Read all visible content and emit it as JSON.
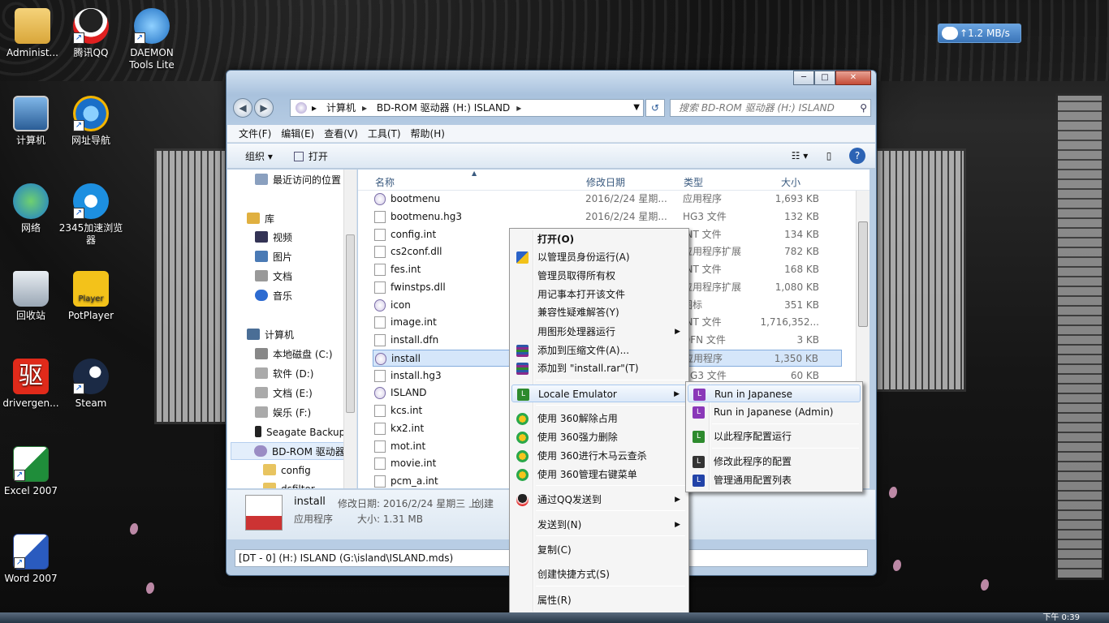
{
  "desktop": {
    "icons": [
      {
        "label": "Administ...",
        "name": "administrator-folder"
      },
      {
        "label": "腾讯QQ",
        "name": "qq"
      },
      {
        "label": "DAEMON Tools Lite",
        "name": "daemon-tools"
      },
      {
        "label": "计算机",
        "name": "computer"
      },
      {
        "label": "网址导航",
        "name": "web-nav"
      },
      {
        "label": "网络",
        "name": "network"
      },
      {
        "label": "2345加速浏览器",
        "name": "browser-2345"
      },
      {
        "label": "回收站",
        "name": "recycle-bin"
      },
      {
        "label": "PotPlayer",
        "name": "potplayer"
      },
      {
        "label": "drivergen...",
        "name": "drivergenius"
      },
      {
        "label": "Steam",
        "name": "steam"
      },
      {
        "label": "Excel 2007",
        "name": "excel"
      },
      {
        "label": "Word 2007",
        "name": "word"
      }
    ],
    "net_speed": "1.2 MB/s",
    "potplayer_badge": "Player",
    "drivergen_glyph": "驱"
  },
  "explorer": {
    "caption": {
      "min": "─",
      "max": "□",
      "close": "✕"
    },
    "address": {
      "crumbs": [
        "计算机",
        "BD-ROM 驱动器 (H:) ISLAND"
      ],
      "search_placeholder": "搜索 BD-ROM 驱动器 (H:) ISLAND"
    },
    "menu": [
      "文件(F)",
      "编辑(E)",
      "查看(V)",
      "工具(T)",
      "帮助(H)"
    ],
    "toolbar": {
      "organize": "组织 ▾",
      "open": "打开"
    },
    "nav_pane": [
      {
        "label": "最近访问的位置",
        "color": "#8aa0bf"
      },
      {
        "label": "库",
        "color": "#e0b040"
      },
      {
        "label": "视频",
        "color": "#335"
      },
      {
        "label": "图片",
        "color": "#4a7ab5"
      },
      {
        "label": "文档",
        "color": "#999"
      },
      {
        "label": "音乐",
        "color": "#2d6bd1"
      },
      {
        "label": "计算机",
        "color": "#4a6e96"
      },
      {
        "label": "本地磁盘 (C:)",
        "color": "#888"
      },
      {
        "label": "软件 (D:)",
        "color": "#aaa"
      },
      {
        "label": "文档 (E:)",
        "color": "#aaa"
      },
      {
        "label": "娱乐 (F:)",
        "color": "#aaa"
      },
      {
        "label": "Seagate Backup",
        "color": "#222"
      },
      {
        "label": "BD-ROM 驱动器",
        "color": "#9a8cc4"
      },
      {
        "label": "config",
        "color": "#e8c460"
      },
      {
        "label": "dsfiltor",
        "color": "#e8c460"
      }
    ],
    "columns": {
      "name": "名称",
      "date": "修改日期",
      "type": "类型",
      "size": "大小"
    },
    "files": [
      {
        "name": "bootmenu",
        "date": "2016/2/24 星期...",
        "type": "应用程序",
        "size": "1,693 KB",
        "app": true
      },
      {
        "name": "bootmenu.hg3",
        "date": "2016/2/24 星期...",
        "type": "HG3 文件",
        "size": "132 KB",
        "app": false
      },
      {
        "name": "config.int",
        "date": "",
        "type": "INT 文件",
        "size": "134 KB",
        "app": false
      },
      {
        "name": "cs2conf.dll",
        "date": "",
        "type": "应用程序扩展",
        "size": "782 KB",
        "app": false
      },
      {
        "name": "fes.int",
        "date": "",
        "type": "INT 文件",
        "size": "168 KB",
        "app": false
      },
      {
        "name": "fwinstps.dll",
        "date": "",
        "type": "应用程序扩展",
        "size": "1,080 KB",
        "app": false
      },
      {
        "name": "icon",
        "date": "",
        "type": "图标",
        "size": "351 KB",
        "app": true
      },
      {
        "name": "image.int",
        "date": "",
        "type": "INT 文件",
        "size": "1,716,352...",
        "app": false
      },
      {
        "name": "install.dfn",
        "date": "",
        "type": "DFN 文件",
        "size": "3 KB",
        "app": false
      },
      {
        "name": "install",
        "date": "",
        "type": "应用程序",
        "size": "1,350 KB",
        "app": true
      },
      {
        "name": "install.hg3",
        "date": "",
        "type": "HG3 文件",
        "size": "60 KB",
        "app": false
      },
      {
        "name": "ISLAND",
        "date": "",
        "type": "",
        "size": "",
        "app": true
      },
      {
        "name": "kcs.int",
        "date": "",
        "type": "",
        "size": "",
        "app": false
      },
      {
        "name": "kx2.int",
        "date": "",
        "type": "",
        "size": "",
        "app": false
      },
      {
        "name": "mot.int",
        "date": "",
        "type": "",
        "size": "",
        "app": false
      },
      {
        "name": "movie.int",
        "date": "",
        "type": "",
        "size": "",
        "app": false
      },
      {
        "name": "pcm_a.int",
        "date": "",
        "type": "",
        "size": "",
        "app": false
      }
    ],
    "details": {
      "name": "install",
      "type": "应用程序",
      "modified": "修改日期: 2016/2/24 星期三 上...",
      "created": "创建",
      "size": "大小: 1.31 MB"
    },
    "status": "[DT - 0] (H:) ISLAND (G:\\island\\ISLAND.mds)"
  },
  "context_menu": {
    "items": [
      {
        "label": "打开(O)",
        "icon": "",
        "sub": false
      },
      {
        "label": "以管理员身份运行(A)",
        "icon": "shield",
        "sub": false
      },
      {
        "label": "管理员取得所有权",
        "icon": "",
        "sub": false
      },
      {
        "label": "用记事本打开该文件",
        "icon": "",
        "sub": false
      },
      {
        "label": "兼容性疑难解答(Y)",
        "icon": "",
        "sub": false
      },
      {
        "label": "用图形处理器运行",
        "icon": "",
        "sub": true
      },
      {
        "label": "添加到压缩文件(A)...",
        "icon": "winrar",
        "sub": false
      },
      {
        "label": "添加到 \"install.rar\"(T)",
        "icon": "winrar",
        "sub": false
      },
      {
        "label": "Locale Emulator",
        "icon": "le",
        "sub": true
      },
      {
        "label": "使用 360解除占用",
        "icon": "360",
        "sub": false
      },
      {
        "label": "使用 360强力删除",
        "icon": "360",
        "sub": false
      },
      {
        "label": "使用 360进行木马云查杀",
        "icon": "360",
        "sub": false
      },
      {
        "label": "使用 360管理右键菜单",
        "icon": "360",
        "sub": false
      },
      {
        "label": "通过QQ发送到",
        "icon": "qq",
        "sub": true
      },
      {
        "label": "发送到(N)",
        "icon": "",
        "sub": true
      },
      {
        "label": "复制(C)",
        "icon": "",
        "sub": false
      },
      {
        "label": "创建快捷方式(S)",
        "icon": "",
        "sub": false
      },
      {
        "label": "属性(R)",
        "icon": "",
        "sub": false
      }
    ]
  },
  "submenu": {
    "items": [
      {
        "label": "Run in Japanese",
        "color": "purple"
      },
      {
        "label": "Run in Japanese (Admin)",
        "color": "purple"
      },
      {
        "label": "以此程序配置运行",
        "color": "green"
      },
      {
        "label": "修改此程序的配置",
        "color": "dark"
      },
      {
        "label": "管理通用配置列表",
        "color": "blue"
      }
    ],
    "icon_letter": "L"
  },
  "taskbar": {
    "clock": "下午 0:39"
  }
}
